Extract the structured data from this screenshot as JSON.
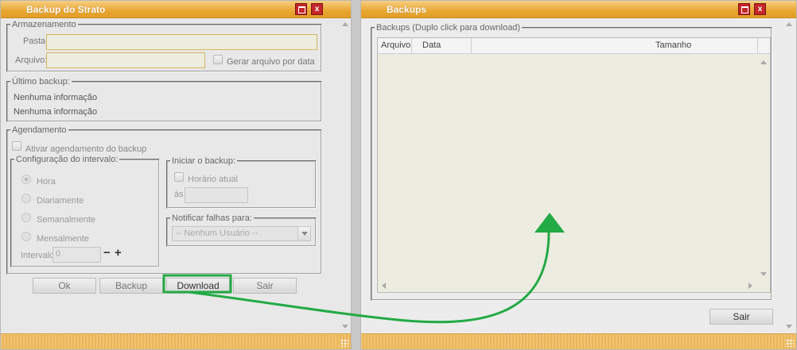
{
  "left_window": {
    "title": "Backup do Strato",
    "storage": {
      "legend": "Armazenamento",
      "folder_label": "Pasta:",
      "folder_value": "",
      "file_label": "Arquivo:",
      "file_value": "",
      "by_date_label": "Gerar arquivo por data"
    },
    "last_backup": {
      "legend": "Último backup:",
      "line1": "Nenhuma informação",
      "line2": "Nenhuma informação"
    },
    "schedule": {
      "legend": "Agendamento",
      "enable_label": "Ativar agendamento do backup",
      "interval_config": {
        "legend": "Configuração do intervalo:",
        "options": [
          "Hora",
          "Diariamente",
          "Semanalmente",
          "Mensalmente"
        ],
        "selected": "Hora",
        "interval_label": "Intervalo",
        "interval_value": "0",
        "minus": "−",
        "plus": "+"
      },
      "start": {
        "legend": "Iniciar o backup:",
        "current_time_label": "Horário atual",
        "at_label": "às",
        "at_value": ""
      },
      "notify": {
        "legend": "Notificar falhas para:",
        "selected": "-- Nenhum Usuário --"
      }
    },
    "buttons": {
      "ok": "Ok",
      "backup": "Backup",
      "download": "Download",
      "exit": "Sair"
    }
  },
  "right_window": {
    "title": "Backups",
    "group_legend": "Backups (Duplo click para download)",
    "columns": [
      "Arquivo",
      "Data",
      "Tamanho"
    ],
    "rows": [],
    "exit_button": "Sair"
  },
  "annotation": {
    "highlight_color": "#22aa44"
  }
}
